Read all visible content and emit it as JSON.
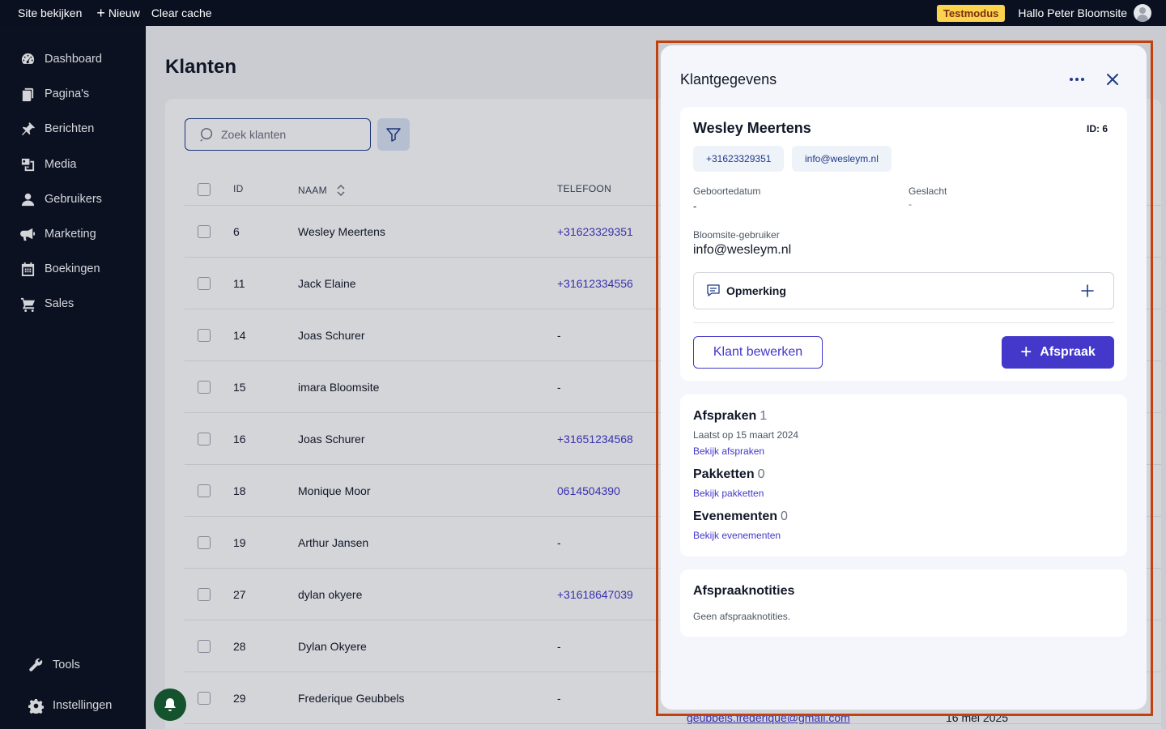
{
  "topbar": {
    "view_site": "Site bekijken",
    "new": "Nieuw",
    "clear_cache": "Clear cache",
    "test_mode": "Testmodus",
    "greeting": "Hallo Peter Bloomsite"
  },
  "sidebar": {
    "items": [
      {
        "label": "Dashboard",
        "icon": "dashboard-icon"
      },
      {
        "label": "Pagina's",
        "icon": "pages-icon"
      },
      {
        "label": "Berichten",
        "icon": "pin-icon"
      },
      {
        "label": "Media",
        "icon": "media-icon"
      },
      {
        "label": "Gebruikers",
        "icon": "user-icon"
      },
      {
        "label": "Marketing",
        "icon": "megaphone-icon"
      },
      {
        "label": "Boekingen",
        "icon": "calendar-icon"
      },
      {
        "label": "Sales",
        "icon": "cart-icon"
      }
    ],
    "tools": "Tools",
    "settings": "Instellingen"
  },
  "main": {
    "title": "Klanten",
    "search_placeholder": "Zoek klanten",
    "columns": {
      "id": "ID",
      "name": "NAAM",
      "phone": "TELEFOON"
    },
    "rows": [
      {
        "id": "6",
        "name": "Wesley Meertens",
        "phone": "+31623329351",
        "is_link": true
      },
      {
        "id": "11",
        "name": "Jack Elaine",
        "phone": "+31612334556",
        "is_link": true
      },
      {
        "id": "14",
        "name": "Joas Schurer",
        "phone": "-",
        "is_link": false
      },
      {
        "id": "15",
        "name": "imara Bloomsite",
        "phone": "-",
        "is_link": false
      },
      {
        "id": "16",
        "name": "Joas Schurer",
        "phone": "+31651234568",
        "is_link": true
      },
      {
        "id": "18",
        "name": "Monique Moor",
        "phone": "0614504390",
        "is_link": true
      },
      {
        "id": "19",
        "name": "Arthur Jansen",
        "phone": "-",
        "is_link": false
      },
      {
        "id": "27",
        "name": "dylan okyere",
        "phone": "+31618647039",
        "is_link": true
      },
      {
        "id": "28",
        "name": "Dylan Okyere",
        "phone": "-",
        "is_link": false
      },
      {
        "id": "29",
        "name": "Frederique Geubbels",
        "phone": "-",
        "is_link": false
      }
    ],
    "last_row_email": "geubbels.frederique@gmail.com",
    "last_row_date": "16 mei 2025"
  },
  "panel": {
    "title": "Klantgegevens",
    "customer_name": "Wesley Meertens",
    "customer_id": "ID: 6",
    "phone": "+31623329351",
    "email": "info@wesleym.nl",
    "birthdate_label": "Geboortedatum",
    "birthdate_value": "-",
    "gender_label": "Geslacht",
    "gender_value": "-",
    "bloomsite_user_label": "Bloomsite-gebruiker",
    "bloomsite_user_value": "info@wesleym.nl",
    "remark_label": "Opmerking",
    "edit_button": "Klant bewerken",
    "appointment_button": "Afspraak",
    "appointments_title": "Afspraken",
    "appointments_count": "1",
    "appointments_last": "Laatst op 15 maart 2024",
    "appointments_link": "Bekijk afspraken",
    "packages_title": "Pakketten",
    "packages_count": "0",
    "packages_link": "Bekijk pakketten",
    "events_title": "Evenementen",
    "events_count": "0",
    "events_link": "Bekijk evenementen",
    "notes_title": "Afspraaknotities",
    "notes_empty": "Geen afspraaknotities."
  },
  "colors": {
    "accent": "#4338ca",
    "sidebar_bg": "#0b1020",
    "test_badge": "#fbd34d",
    "highlight_border": "#c2410c"
  }
}
